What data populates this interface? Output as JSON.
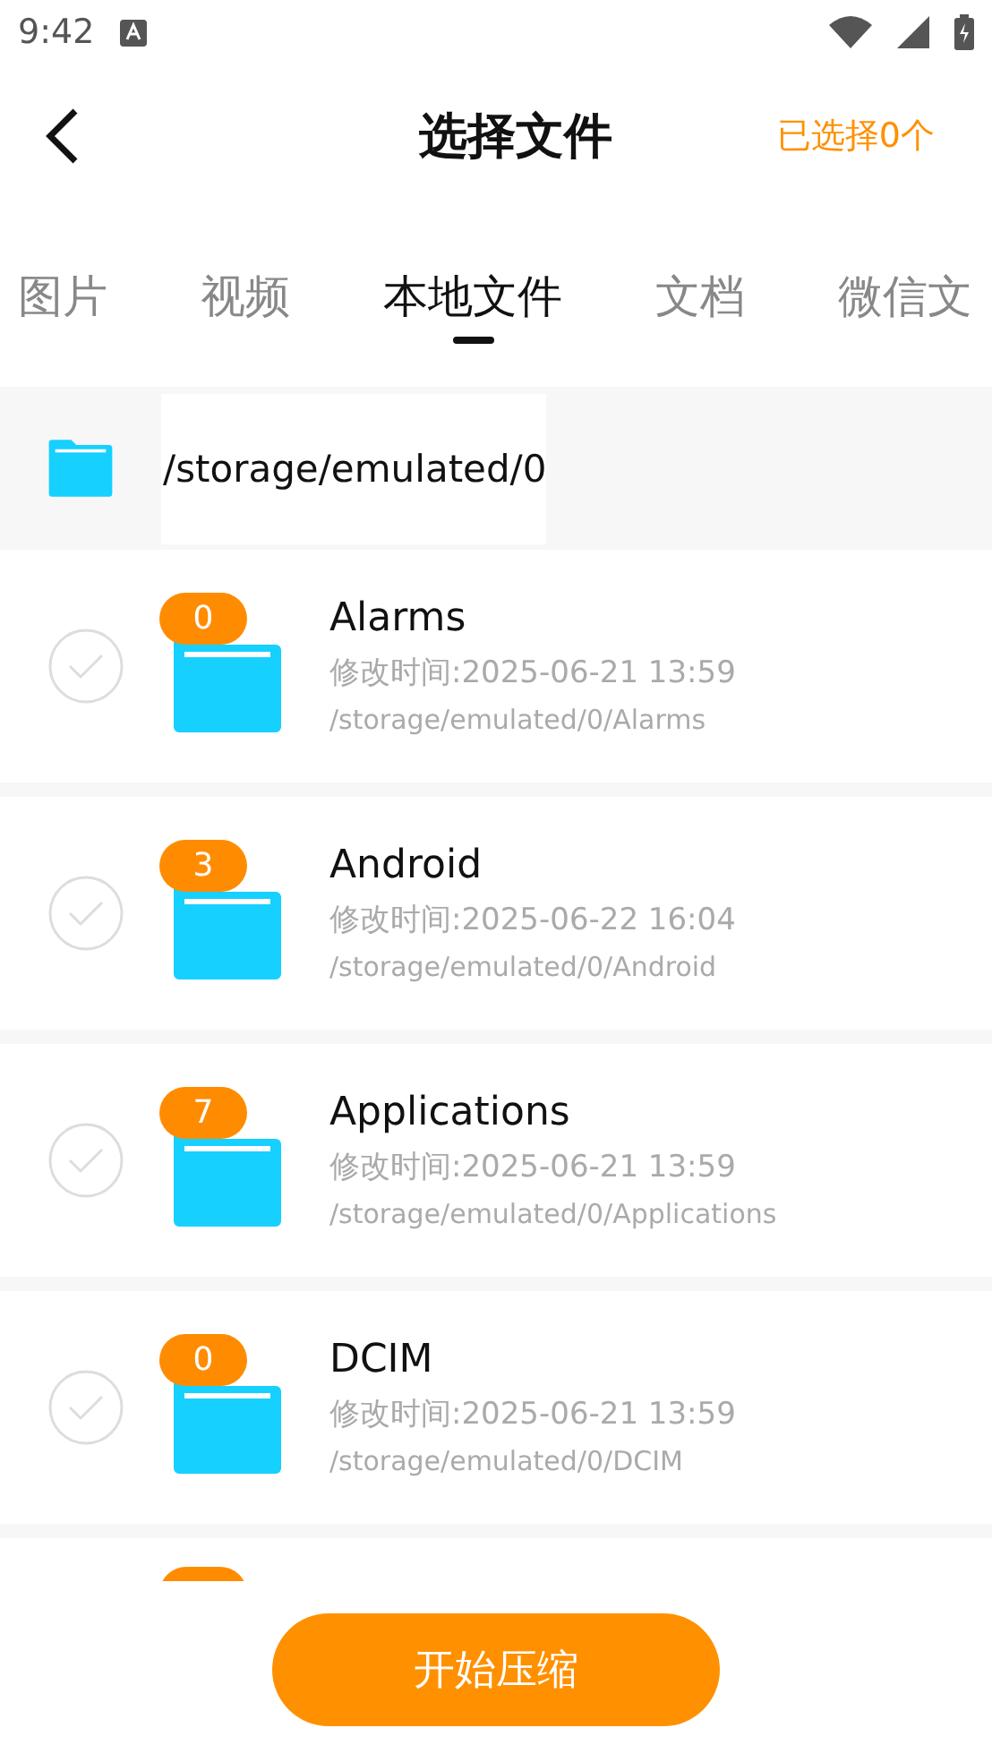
{
  "status_bar": {
    "time": "9:42"
  },
  "header": {
    "title": "选择文件",
    "selected_count": "已选择0个"
  },
  "tabs": [
    {
      "label": "图片",
      "selected": false
    },
    {
      "label": "视频",
      "selected": false
    },
    {
      "label": "本地文件",
      "selected": true
    },
    {
      "label": "文档",
      "selected": false
    },
    {
      "label": "微信文",
      "selected": false
    }
  ],
  "path_bar": {
    "path": "/storage/emulated/0"
  },
  "files": [
    {
      "name": "Alarms",
      "count": "0",
      "modified": "修改时间:2025-06-21 13:59",
      "path": "/storage/emulated/0/Alarms",
      "checked": false
    },
    {
      "name": "Android",
      "count": "3",
      "modified": "修改时间:2025-06-22 16:04",
      "path": "/storage/emulated/0/Android",
      "checked": false
    },
    {
      "name": "Applications",
      "count": "7",
      "modified": "修改时间:2025-06-21 13:59",
      "path": "/storage/emulated/0/Applications",
      "checked": false
    },
    {
      "name": "DCIM",
      "count": "0",
      "modified": "修改时间:2025-06-21 13:59",
      "path": "/storage/emulated/0/DCIM",
      "checked": false
    }
  ],
  "action_button": "开始压缩"
}
